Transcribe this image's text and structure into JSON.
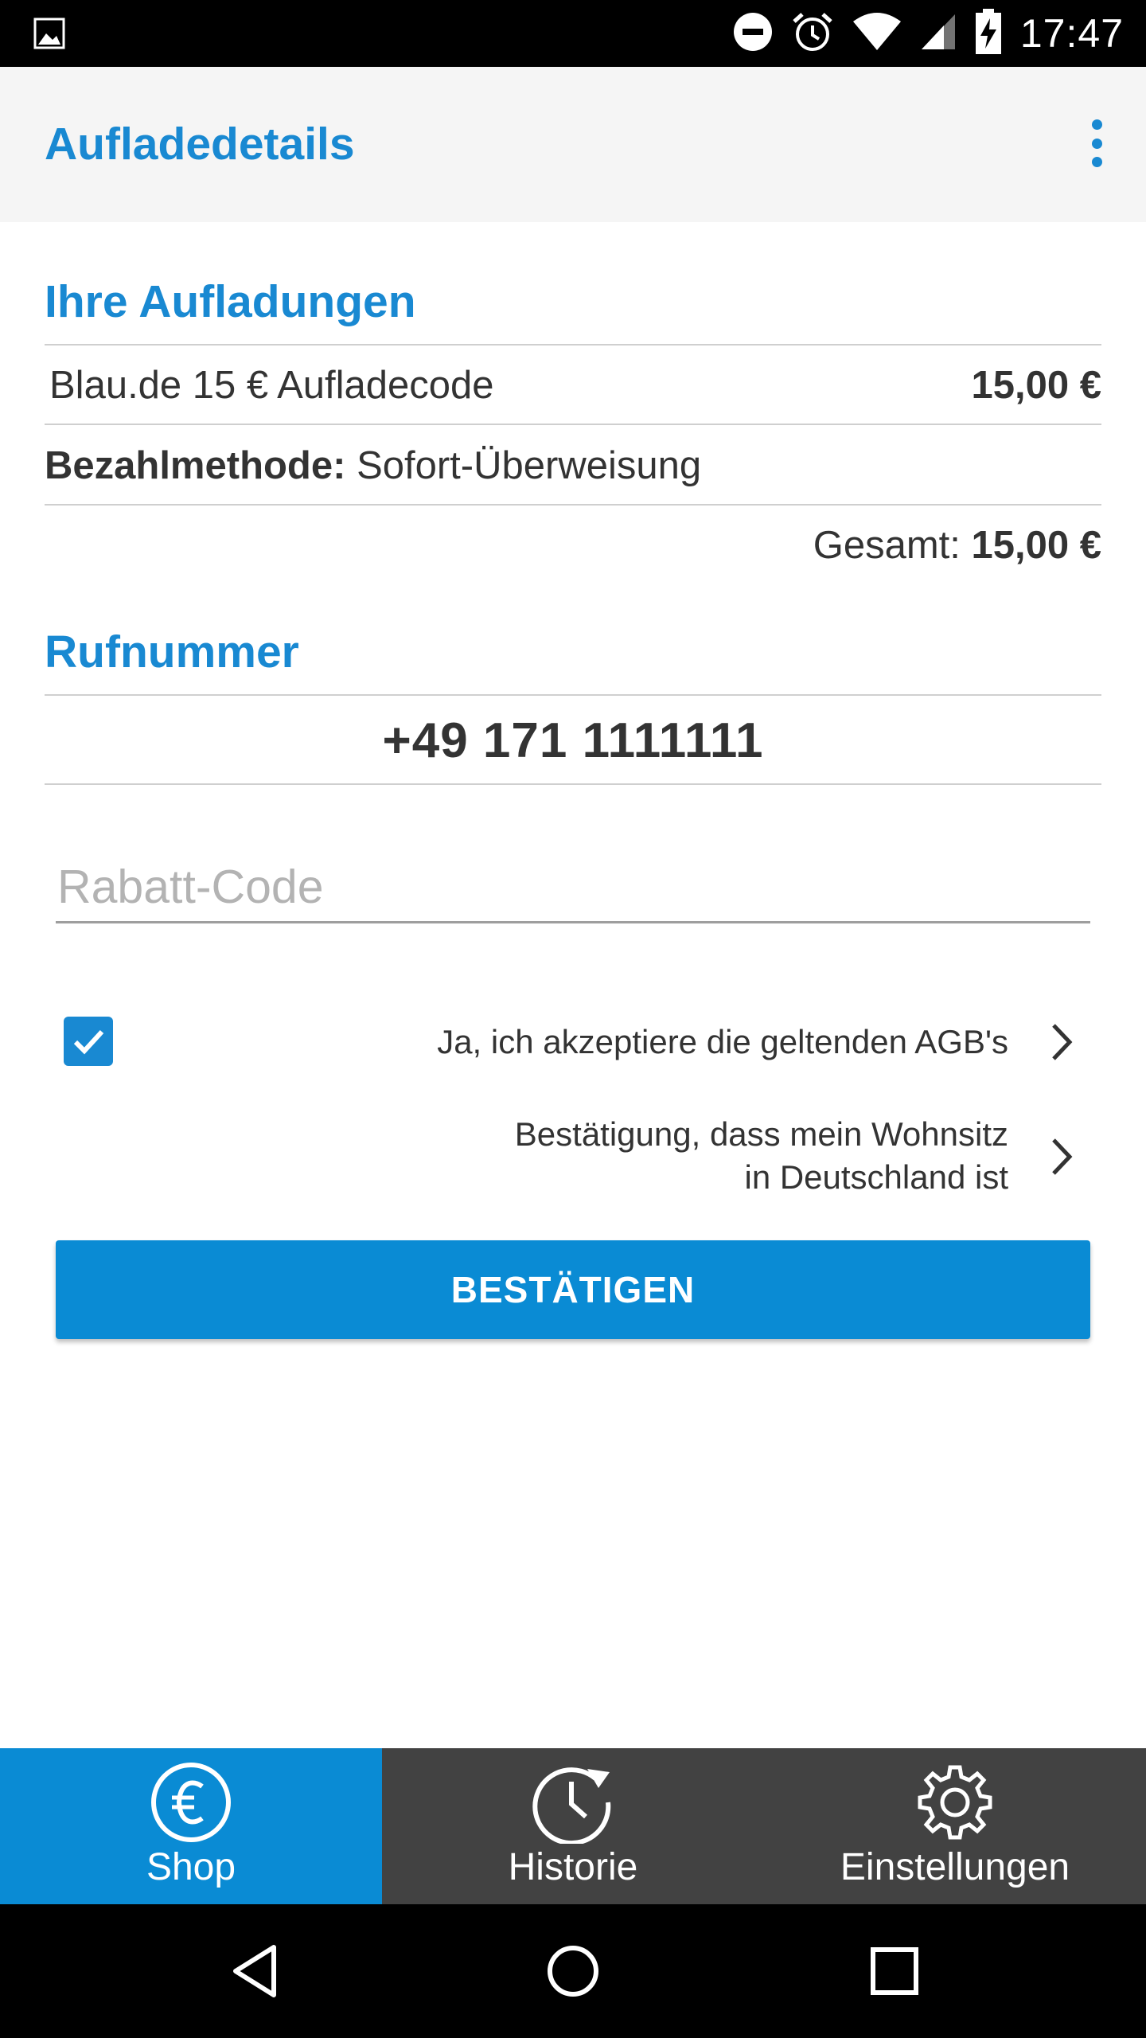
{
  "status_bar": {
    "time": "17:47",
    "icons": [
      "image-icon",
      "dnd-icon",
      "alarm-icon",
      "wifi-icon",
      "signal-icon",
      "battery-charging-icon"
    ]
  },
  "app_bar": {
    "title": "Aufladedetails",
    "menu_icon": "overflow-menu-icon"
  },
  "charges": {
    "title": "Ihre Aufladungen",
    "item_name": "Blau.de 15 € Aufladecode",
    "item_price": "15,00 €",
    "payment_label": "Bezahlmethode:",
    "payment_value": "Sofort-Überweisung",
    "total_label": "Gesamt:",
    "total_value": "15,00 €"
  },
  "phone": {
    "title": "Rufnummer",
    "number": "+49 171 1111111"
  },
  "discount": {
    "placeholder": "Rabatt-Code",
    "value": ""
  },
  "terms": {
    "agb_text": "Ja, ich akzeptiere die geltenden AGB's",
    "agb_checked": true,
    "residence_line1": "Bestätigung, dass mein Wohnsitz",
    "residence_line2": "in Deutschland ist"
  },
  "confirm_label": "BESTÄTIGEN",
  "bottom_nav": [
    {
      "label": "Shop",
      "icon": "euro-icon",
      "active": true
    },
    {
      "label": "Historie",
      "icon": "history-icon",
      "active": false
    },
    {
      "label": "Einstellungen",
      "icon": "gear-icon",
      "active": false
    }
  ],
  "colors": {
    "accent": "#1989d2",
    "button": "#0a8bd4",
    "nav_bg": "#424242"
  }
}
